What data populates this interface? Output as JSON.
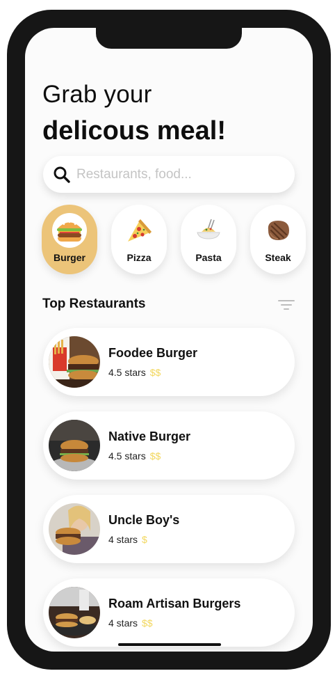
{
  "headline": {
    "line1": "Grab your",
    "line2": "delicous meal!"
  },
  "search": {
    "placeholder": "Restaurants, food..."
  },
  "categories": [
    {
      "label": "Burger",
      "icon": "burger-icon",
      "active": true
    },
    {
      "label": "Pizza",
      "icon": "pizza-icon",
      "active": false
    },
    {
      "label": "Pasta",
      "icon": "pasta-icon",
      "active": false
    },
    {
      "label": "Steak",
      "icon": "steak-icon",
      "active": false
    }
  ],
  "section": {
    "title": "Top Restaurants",
    "filter_icon": "filter-icon"
  },
  "restaurants": [
    {
      "name": "Foodee Burger",
      "rating": "4.5 stars",
      "price": "$$"
    },
    {
      "name": "Native Burger",
      "rating": "4.5 stars",
      "price": "$$"
    },
    {
      "name": "Uncle Boy's",
      "rating": "4 stars",
      "price": "$"
    },
    {
      "name": "Roam Artisan Burgers",
      "rating": "4 stars",
      "price": "$$"
    }
  ],
  "colors": {
    "accent": "#ecc479",
    "price": "#f2d75d",
    "text": "#111111",
    "placeholder": "#c4c4c4",
    "frame": "#161616"
  }
}
